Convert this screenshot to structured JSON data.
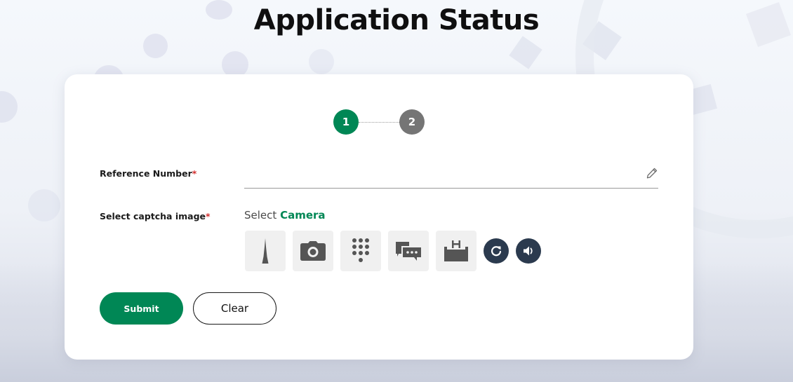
{
  "page": {
    "title": "Application Status"
  },
  "stepper": {
    "steps": [
      {
        "number": "1",
        "state": "active"
      },
      {
        "number": "2",
        "state": "inactive"
      }
    ]
  },
  "form": {
    "reference_number": {
      "label": "Reference Number",
      "required_mark": "*",
      "value": "",
      "placeholder": "",
      "edit_icon": "pencil-icon"
    },
    "captcha": {
      "label": "Select captcha image",
      "required_mark": "*",
      "prompt_prefix": "Select",
      "prompt_target": "Camera",
      "options": [
        {
          "name": "tower",
          "icon": "tower-icon"
        },
        {
          "name": "camera",
          "icon": "camera-icon"
        },
        {
          "name": "keypad",
          "icon": "keypad-icon"
        },
        {
          "name": "chat",
          "icon": "chat-icon"
        },
        {
          "name": "hospital",
          "icon": "hospital-icon"
        }
      ],
      "refresh_icon": "refresh-icon",
      "audio_icon": "speaker-icon"
    },
    "buttons": {
      "submit": "Submit",
      "clear": "Clear"
    }
  },
  "colors": {
    "primary": "#008755",
    "inactive_step": "#757575",
    "dark_button": "#2b3a4e",
    "required": "#d32f2f"
  }
}
